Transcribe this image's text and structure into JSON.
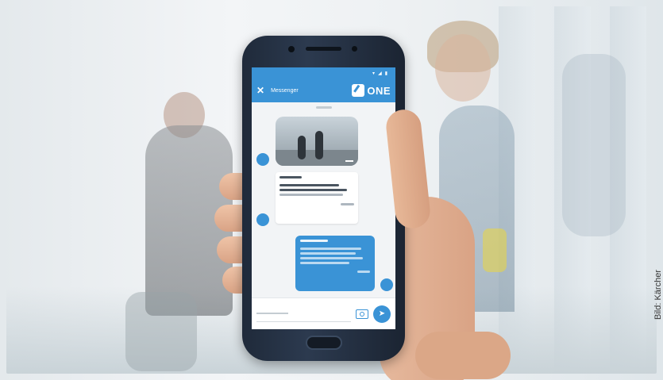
{
  "photo": {
    "credit": "Bild: Kärcher"
  },
  "app": {
    "title": "Messenger",
    "logo_text": "ONE",
    "status_time": "",
    "input_placeholder": "",
    "icons": {
      "close": "close-icon",
      "camera": "camera-icon",
      "send": "send-icon"
    },
    "colors": {
      "accent": "#3a93d6"
    }
  }
}
